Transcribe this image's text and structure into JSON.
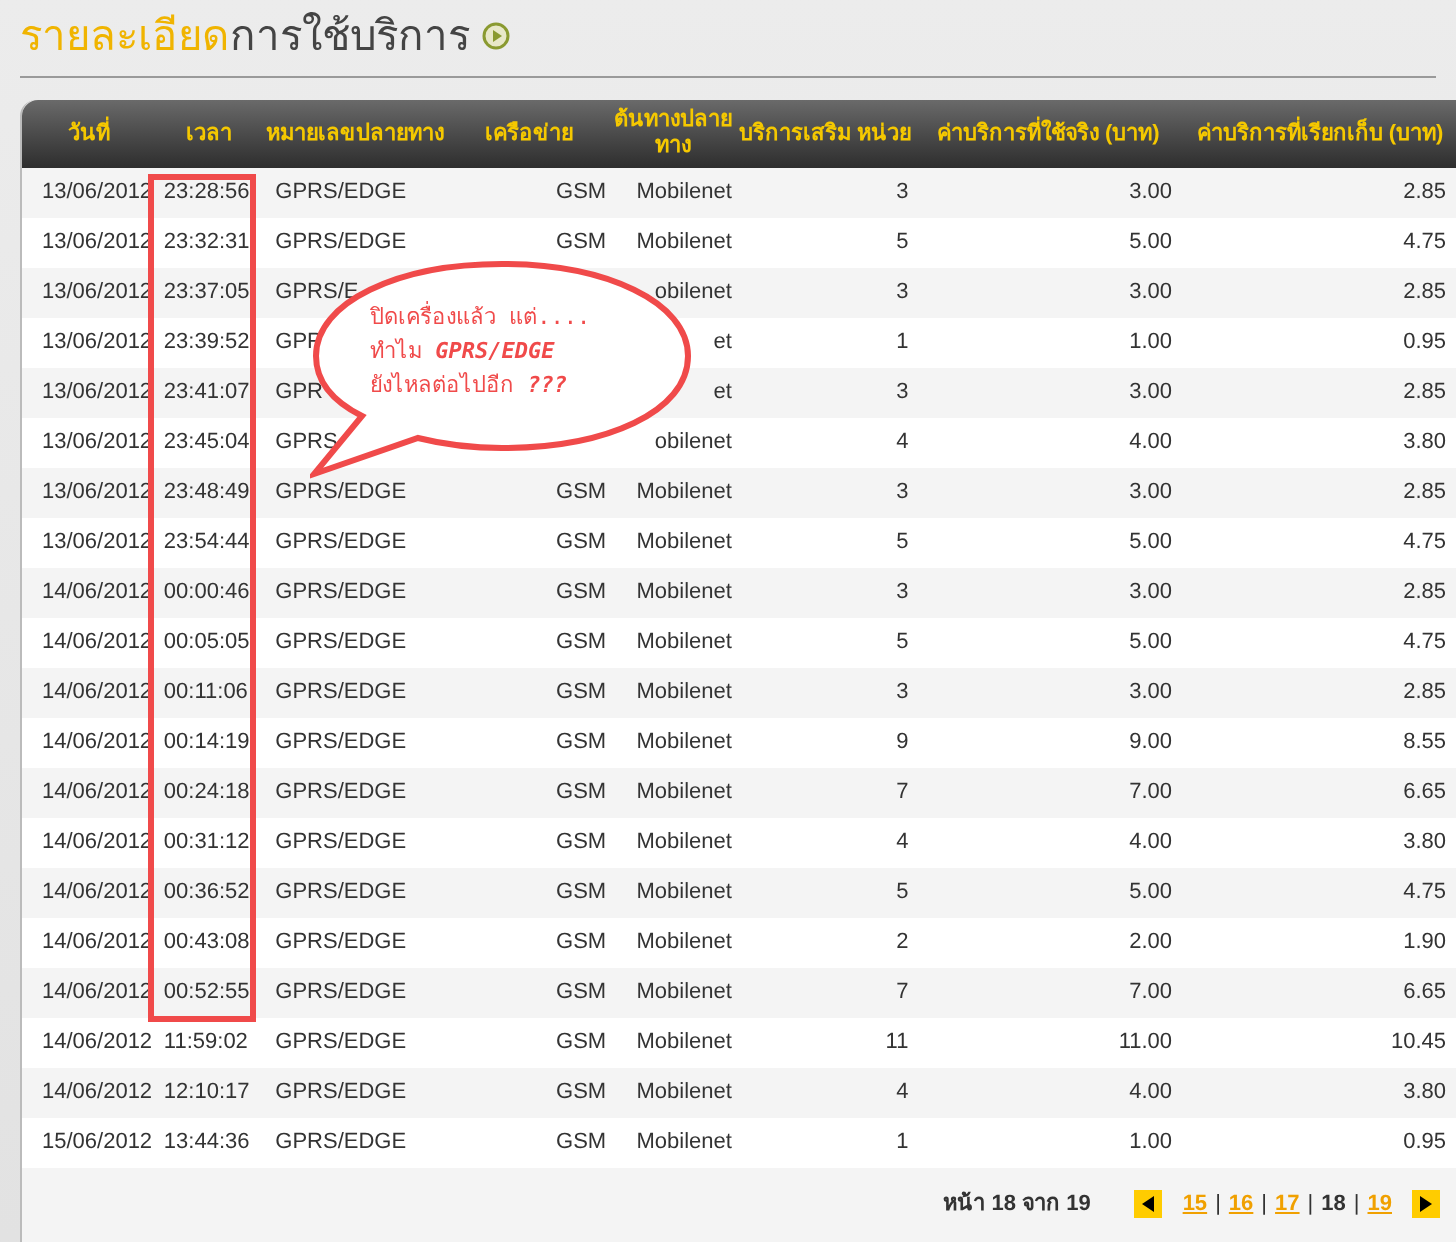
{
  "title": {
    "highlight": "รายละเอียด",
    "rest": "การใช้บริการ"
  },
  "table": {
    "columns": [
      "วันที่",
      "เวลา",
      "หมายเลขปลายทาง",
      "เครือข่าย",
      "ต้นทางปลายทาง",
      "บริการเสริม",
      "หน่วย",
      "ค่าบริการที่ใช้จริง (บาท)",
      "ค่าบริการที่เรียกเก็บ (บาท)"
    ],
    "rows": [
      [
        "13/06/2012",
        "23:28:56",
        "GPRS/EDGE",
        "GSM",
        "Mobilenet",
        null,
        "3",
        "3.00",
        "2.85"
      ],
      [
        "13/06/2012",
        "23:32:31",
        "GPRS/EDGE",
        "GSM",
        "Mobilenet",
        null,
        "5",
        "5.00",
        "4.75"
      ],
      [
        "13/06/2012",
        "23:37:05",
        "GPRS/E",
        null,
        "obilenet",
        null,
        "3",
        "3.00",
        "2.85"
      ],
      [
        "13/06/2012",
        "23:39:52",
        "GPR",
        null,
        "et",
        null,
        "1",
        "1.00",
        "0.95"
      ],
      [
        "13/06/2012",
        "23:41:07",
        "GPR",
        null,
        "et",
        null,
        "3",
        "3.00",
        "2.85"
      ],
      [
        "13/06/2012",
        "23:45:04",
        "GPRS",
        null,
        "obilenet",
        null,
        "4",
        "4.00",
        "3.80"
      ],
      [
        "13/06/2012",
        "23:48:49",
        "GPRS/EDGE",
        "GSM",
        "Mobilenet",
        null,
        "3",
        "3.00",
        "2.85"
      ],
      [
        "13/06/2012",
        "23:54:44",
        "GPRS/EDGE",
        "GSM",
        "Mobilenet",
        null,
        "5",
        "5.00",
        "4.75"
      ],
      [
        "14/06/2012",
        "00:00:46",
        "GPRS/EDGE",
        "GSM",
        "Mobilenet",
        null,
        "3",
        "3.00",
        "2.85"
      ],
      [
        "14/06/2012",
        "00:05:05",
        "GPRS/EDGE",
        "GSM",
        "Mobilenet",
        null,
        "5",
        "5.00",
        "4.75"
      ],
      [
        "14/06/2012",
        "00:11:06",
        "GPRS/EDGE",
        "GSM",
        "Mobilenet",
        null,
        "3",
        "3.00",
        "2.85"
      ],
      [
        "14/06/2012",
        "00:14:19",
        "GPRS/EDGE",
        "GSM",
        "Mobilenet",
        null,
        "9",
        "9.00",
        "8.55"
      ],
      [
        "14/06/2012",
        "00:24:18",
        "GPRS/EDGE",
        "GSM",
        "Mobilenet",
        null,
        "7",
        "7.00",
        "6.65"
      ],
      [
        "14/06/2012",
        "00:31:12",
        "GPRS/EDGE",
        "GSM",
        "Mobilenet",
        null,
        "4",
        "4.00",
        "3.80"
      ],
      [
        "14/06/2012",
        "00:36:52",
        "GPRS/EDGE",
        "GSM",
        "Mobilenet",
        null,
        "5",
        "5.00",
        "4.75"
      ],
      [
        "14/06/2012",
        "00:43:08",
        "GPRS/EDGE",
        "GSM",
        "Mobilenet",
        null,
        "2",
        "2.00",
        "1.90"
      ],
      [
        "14/06/2012",
        "00:52:55",
        "GPRS/EDGE",
        "GSM",
        "Mobilenet",
        null,
        "7",
        "7.00",
        "6.65"
      ],
      [
        "14/06/2012",
        "11:59:02",
        "GPRS/EDGE",
        "GSM",
        "Mobilenet",
        null,
        "11",
        "11.00",
        "10.45"
      ],
      [
        "14/06/2012",
        "12:10:17",
        "GPRS/EDGE",
        "GSM",
        "Mobilenet",
        null,
        "4",
        "4.00",
        "3.80"
      ],
      [
        "15/06/2012",
        "13:44:36",
        "GPRS/EDGE",
        "GSM",
        "Mobilenet",
        null,
        "1",
        "1.00",
        "0.95"
      ]
    ]
  },
  "pager": {
    "label": "หน้า 18 จาก 19",
    "separator": "|",
    "pages": [
      {
        "label": "15",
        "selected": false
      },
      {
        "label": "16",
        "selected": false
      },
      {
        "label": "17",
        "selected": false
      },
      {
        "label": "18",
        "selected": true
      },
      {
        "label": "19",
        "selected": false
      }
    ]
  },
  "callout": {
    "lines": [
      "ปิดเครื่องแล้ว แต่....",
      "ทำไม **GPRS/EDGE**",
      "ยังไหลต่อไปอีก **???**"
    ]
  }
}
